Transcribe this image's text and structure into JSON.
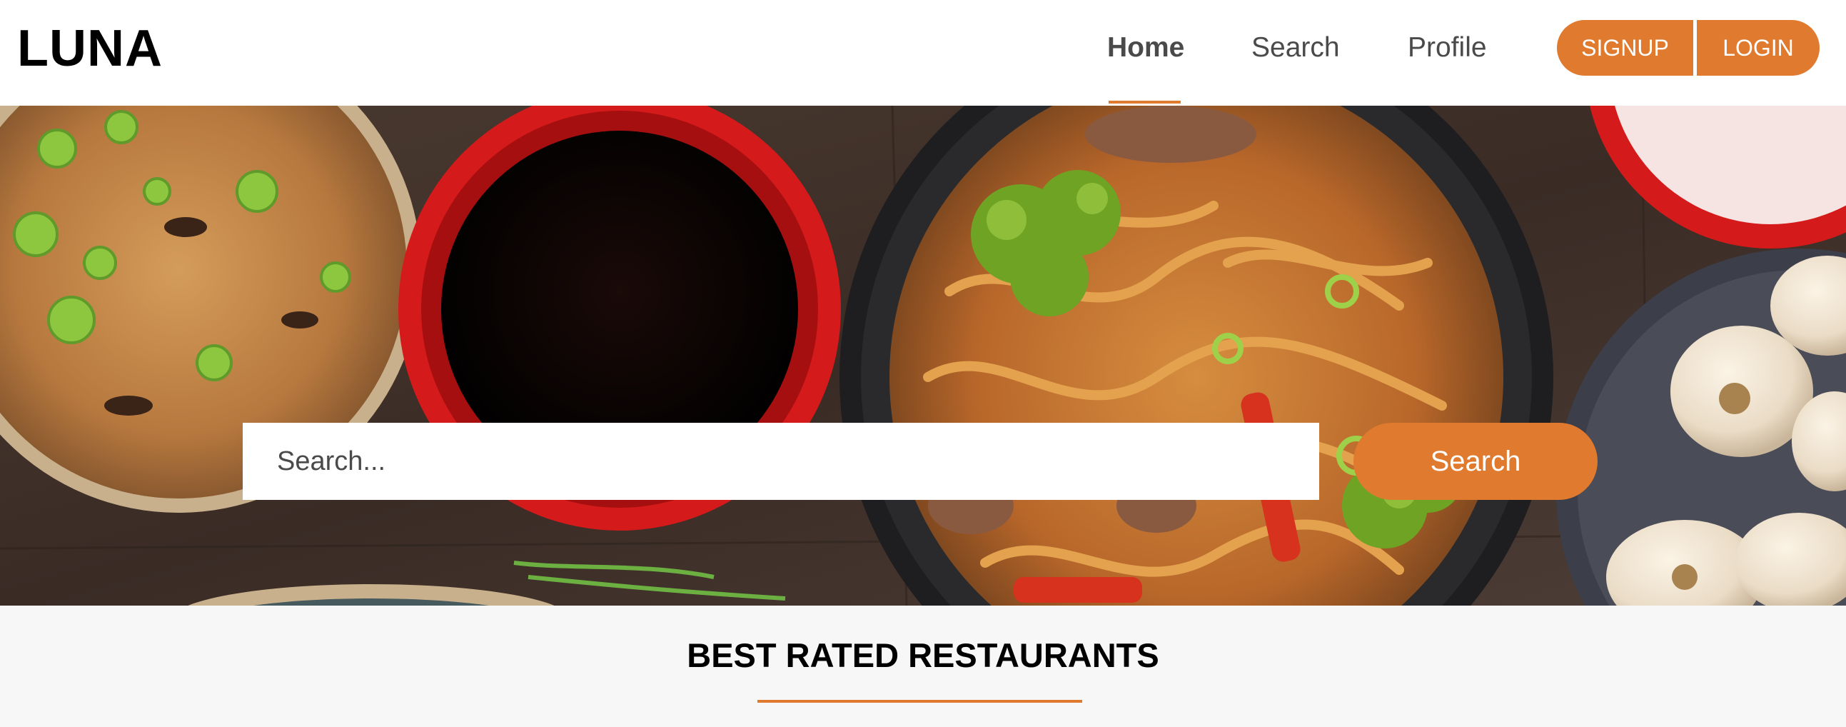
{
  "brand": {
    "name": "LUNA"
  },
  "nav": {
    "items": [
      {
        "label": "Home",
        "active": true
      },
      {
        "label": "Search",
        "active": false
      },
      {
        "label": "Profile",
        "active": false
      }
    ],
    "signup_label": "SIGNUP",
    "login_label": "LOGIN"
  },
  "hero": {
    "image": "food-bowls-photo",
    "search": {
      "placeholder": "Search...",
      "button_label": "Search"
    }
  },
  "section": {
    "title": "BEST RATED RESTAURANTS"
  },
  "colors": {
    "accent": "#e07a2e",
    "nav_bg": "#ffffff",
    "page_bg": "#f7f7f7",
    "text_dark": "#000000",
    "text_nav": "#4a4a4a"
  }
}
